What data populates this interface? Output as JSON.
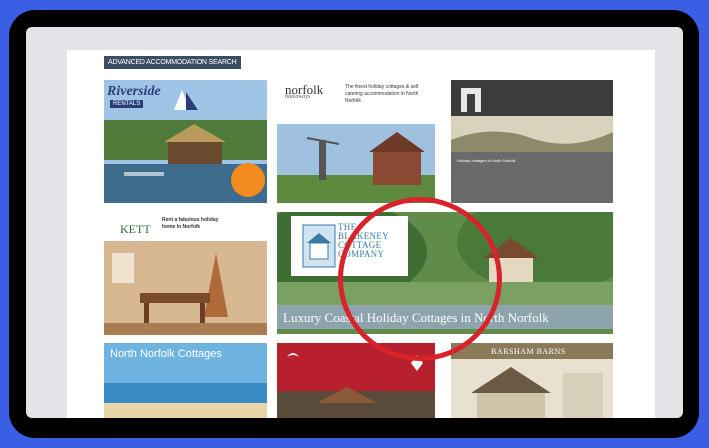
{
  "page": {
    "section_heading": "ADVANCED ACCOMMODATION SEARCH"
  },
  "tiles": {
    "riverside": {
      "logo": "Riverside",
      "sub": "RENTALS"
    },
    "norfolk_hideaways": {
      "logo": "norfolk",
      "sub": "hideaways",
      "tagline": "The finest holiday cottages & self catering accommodation in North Norfolk"
    },
    "coastal_cottages": {
      "text": "Holiday cottages in North Norfolk"
    },
    "kett": {
      "logo": "KETT",
      "tagline": "Rent a fabulous holiday home in Norfolk"
    },
    "blakeney": {
      "name": "THE BLAKENEY COTTAGE COMPANY",
      "tagline": "Luxury Coastal Holiday Cottages in North Norfolk"
    },
    "north_norfolk_cottages": {
      "title": "North Norfolk Cottages"
    },
    "barsham_barns": {
      "title": "BARSHAM BARNS"
    }
  },
  "colors": {
    "background": "#3a5fe4",
    "frame": "#000000",
    "highlight_circle": "#d8232a",
    "heading_bg": "#3d4d62"
  }
}
